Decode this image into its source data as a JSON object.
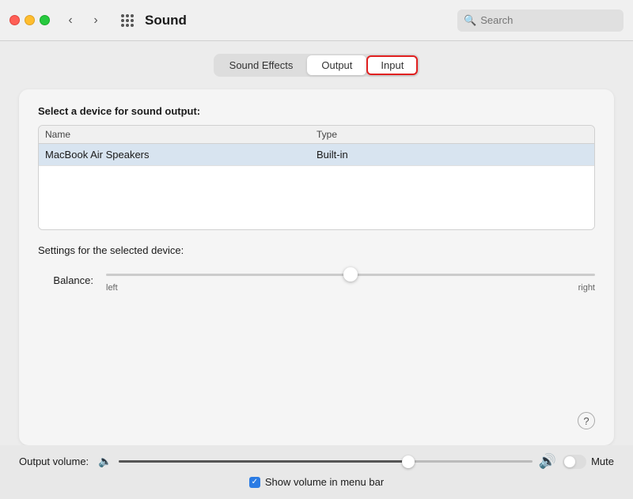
{
  "titlebar": {
    "title": "Sound",
    "search_placeholder": "Search",
    "back_icon": "‹",
    "forward_icon": "›"
  },
  "tabs": {
    "sound_effects_label": "Sound Effects",
    "output_label": "Output",
    "input_label": "Input",
    "active": "output"
  },
  "panel": {
    "select_device_title": "Select a device for sound output:",
    "table": {
      "col_name": "Name",
      "col_type": "Type",
      "rows": [
        {
          "name": "MacBook Air Speakers",
          "type": "Built-in"
        }
      ]
    },
    "settings_title": "Settings for the selected device:",
    "balance_label": "Balance:",
    "slider_left": "left",
    "slider_right": "right",
    "help_label": "?"
  },
  "bottom": {
    "output_volume_label": "Output volume:",
    "mute_label": "Mute",
    "show_volume_label": "Show volume in menu bar"
  }
}
